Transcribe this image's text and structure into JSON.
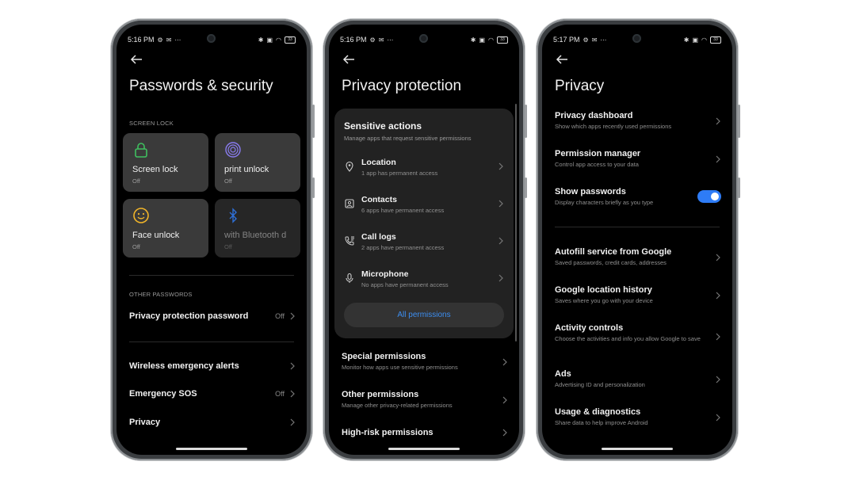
{
  "phones": [
    {
      "status": {
        "time": "5:16 PM",
        "battery": "33"
      },
      "title": "Passwords & security",
      "screen_lock_label": "SCREEN LOCK",
      "tiles": [
        {
          "name": "Screen lock",
          "sub": "Off"
        },
        {
          "name": "print unlock",
          "sub": "Off"
        },
        {
          "name": "Face unlock",
          "sub": "Off"
        },
        {
          "name": "with Bluetooth d",
          "sub": "Off"
        }
      ],
      "other_passwords_label": "OTHER PASSWORDS",
      "rows": [
        {
          "label": "Privacy protection password",
          "value": "Off"
        },
        {
          "label": "Wireless emergency alerts",
          "value": ""
        },
        {
          "label": "Emergency SOS",
          "value": "Off"
        },
        {
          "label": "Privacy",
          "value": ""
        }
      ]
    },
    {
      "status": {
        "time": "5:16 PM",
        "battery": "33"
      },
      "title": "Privacy protection",
      "card": {
        "title": "Sensitive actions",
        "subtitle": "Manage apps that request sensitive permissions",
        "perms": [
          {
            "name": "Location",
            "sub": "1 app has permanent access",
            "icon": "location-pin-icon"
          },
          {
            "name": "Contacts",
            "sub": "6 apps have permanent access",
            "icon": "contacts-icon"
          },
          {
            "name": "Call logs",
            "sub": "2 apps have permanent access",
            "icon": "call-log-icon"
          },
          {
            "name": "Microphone",
            "sub": "No apps have permanent access",
            "icon": "microphone-icon"
          }
        ],
        "all_permissions": "All permissions"
      },
      "items": [
        {
          "label": "Special permissions",
          "sub": "Monitor how apps use sensitive permissions"
        },
        {
          "label": "Other permissions",
          "sub": "Manage other privacy-related permissions"
        },
        {
          "label": "High-risk permissions",
          "sub": ""
        }
      ]
    },
    {
      "status": {
        "time": "5:17 PM",
        "battery": "33"
      },
      "title": "Privacy",
      "items": [
        {
          "label": "Privacy dashboard",
          "sub": "Show which apps recently used permissions"
        },
        {
          "label": "Permission manager",
          "sub": "Control app access to your data"
        },
        {
          "label": "Show passwords",
          "sub": "Display characters briefly as you type"
        },
        {
          "label": "Autofill service from Google",
          "sub": "Saved passwords, credit cards, addresses"
        },
        {
          "label": "Google location history",
          "sub": "Saves where you go with your device"
        },
        {
          "label": "Activity controls",
          "sub": "Choose the activities and info you allow Google to save"
        },
        {
          "label": "Ads",
          "sub": "Advertising ID and personalization"
        },
        {
          "label": "Usage & diagnostics",
          "sub": "Share data to help improve Android"
        }
      ],
      "show_passwords_enabled": true
    }
  ],
  "colors": {
    "accent": "#2e7cf6",
    "link": "#3d8ef0",
    "lock_green": "#3fbf5f",
    "fingerprint_purple": "#8a7cf0",
    "face_yellow": "#f0b429"
  }
}
